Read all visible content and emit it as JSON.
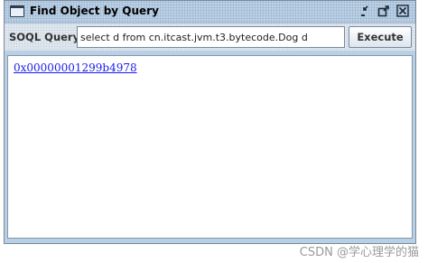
{
  "window": {
    "title": "Find Object by Query",
    "controls": {
      "minimize_icon": "minimize-icon",
      "maximize_icon": "maximize-icon",
      "close_icon": "close-icon"
    }
  },
  "query_bar": {
    "label": "SOQL Query :",
    "query_value": "select d from cn.itcast.jvm.t3.bytecode.Dog d",
    "execute_label": "Execute"
  },
  "results": {
    "items": [
      "0x00000001299b4978"
    ]
  },
  "watermark": "CSDN @学心理学的猫",
  "colors": {
    "title_bar": "#b8cfe5",
    "link": "#1a1aee",
    "panel": "#dfe6ee"
  }
}
